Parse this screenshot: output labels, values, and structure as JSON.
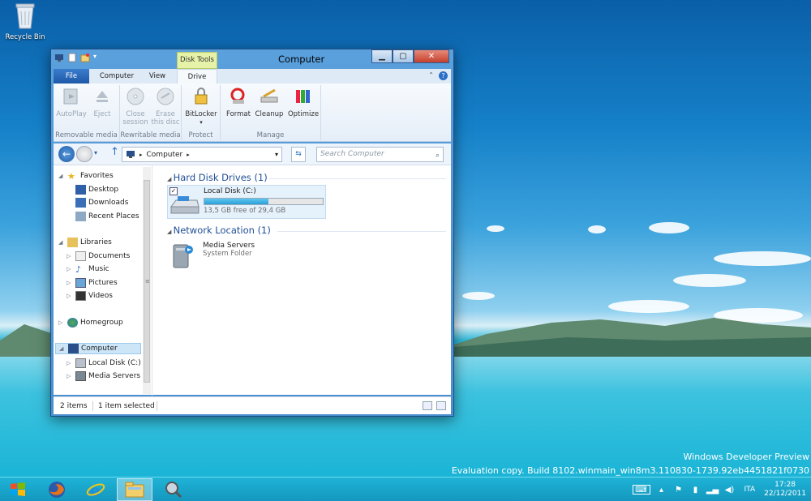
{
  "desktop": {
    "recycle_bin": "Recycle Bin"
  },
  "watermark": {
    "line1": "Windows Developer Preview",
    "line2": "Evaluation copy. Build 8102.winmain_win8m3.110830-1739.92eb4451821f0730"
  },
  "window": {
    "title": "Computer",
    "context_tab": "Disk Tools",
    "tabs": {
      "file": "File",
      "computer": "Computer",
      "view": "View",
      "drive": "Drive"
    },
    "ribbon": {
      "groups": {
        "removable": "Removable media",
        "rewritable": "Rewritable media",
        "protect": "Protect",
        "manage": "Manage"
      },
      "buttons": {
        "autoplay": "AutoPlay",
        "eject": "Eject",
        "close_session": "Close session",
        "erase_disc": "Erase this disc",
        "bitlocker": "BitLocker",
        "format": "Format",
        "cleanup": "Cleanup",
        "optimize": "Optimize"
      }
    },
    "address": {
      "location": "Computer",
      "search_placeholder": "Search Computer"
    },
    "nav": {
      "favorites": "Favorites",
      "desktop": "Desktop",
      "downloads": "Downloads",
      "recent": "Recent Places",
      "libraries": "Libraries",
      "documents": "Documents",
      "music": "Music",
      "pictures": "Pictures",
      "videos": "Videos",
      "homegroup": "Homegroup",
      "computer": "Computer",
      "local_disk": "Local Disk (C:)",
      "media_servers": "Media Servers"
    },
    "main": {
      "hdd_header": "Hard Disk Drives (1)",
      "net_header": "Network Location (1)",
      "disk": {
        "name": "Local Disk (C:)",
        "free": "13,5 GB free of 29,4 GB",
        "used_fraction": 0.54
      },
      "media": {
        "name": "Media Servers",
        "type": "System Folder"
      }
    },
    "status": {
      "items": "2 items",
      "selected": "1 item selected"
    }
  },
  "taskbar": {
    "lang": "ITA",
    "time": "17:28",
    "date": "22/12/2011"
  }
}
